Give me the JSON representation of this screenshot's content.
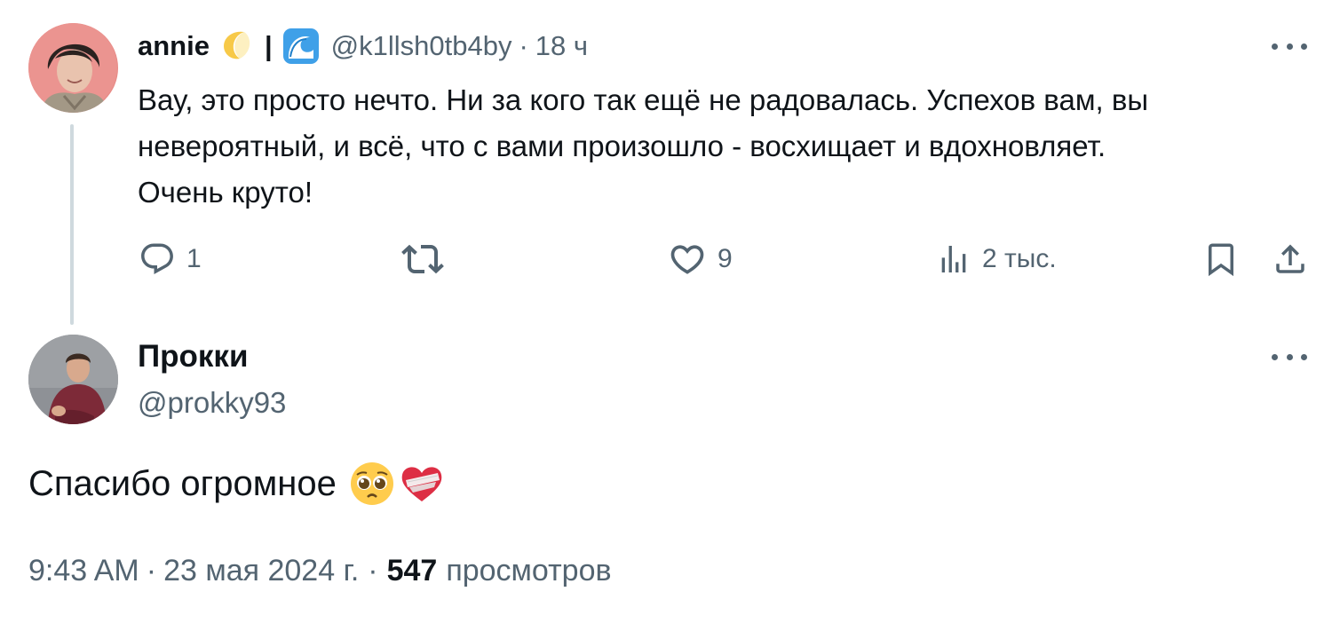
{
  "reply": {
    "display_name": "annie",
    "name_separator": "|",
    "handle": "@k1llsh0tb4by",
    "dot": "·",
    "time": "18 ч",
    "text": "Вау, это просто нечто. Ни за кого так ещё не радовалась. Успехов вам, вы\nневероятный, и всё, что с вами произошло - восхищает и вдохновляет.\nОчень круто!",
    "actions": {
      "replies": "1",
      "retweets": "",
      "likes": "9",
      "views": "2 тыс."
    },
    "name_emoji_icons": [
      "crescent-moon-icon",
      "water-wave-icon"
    ]
  },
  "main": {
    "display_name": "Прокки",
    "handle": "@prokky93",
    "text": "Спасибо огромное",
    "text_emoji_icons": [
      "pleading-face-icon",
      "mending-heart-icon"
    ],
    "time": "9:43 AM",
    "dot": "·",
    "date": "23 мая 2024 г.",
    "views_count": "547",
    "views_label": "просмотров"
  },
  "colors": {
    "text_primary": "#0f1419",
    "text_secondary": "#536471",
    "thread_line": "#cfd9de"
  }
}
